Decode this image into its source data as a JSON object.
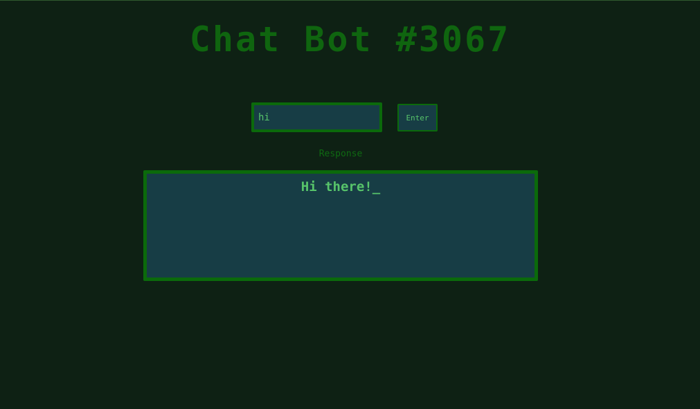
{
  "header": {
    "title": "Chat Bot #3067"
  },
  "chat_form": {
    "input_value": "hi",
    "enter_label": "Enter"
  },
  "response": {
    "label": "Response",
    "text": "Hi there!",
    "cursor": "_"
  },
  "colors": {
    "background": "#0e2114",
    "accent_green": "#0b6a0b",
    "text_green": "#57c46a",
    "panel": "#173d45"
  }
}
